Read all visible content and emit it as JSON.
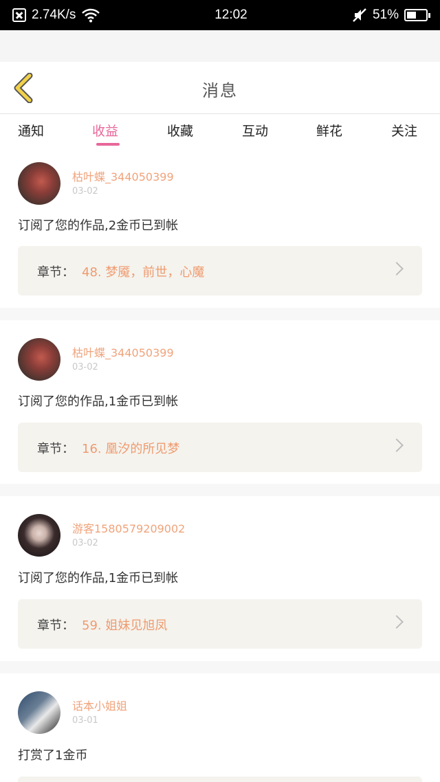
{
  "status_bar": {
    "network_speed": "2.74K/s",
    "time": "12:02",
    "battery": "51%",
    "battery_level": 0.51,
    "icons": [
      "close-box-icon",
      "wifi-icon",
      "mute-icon",
      "battery-icon"
    ]
  },
  "header": {
    "title": "消息",
    "back_icon": "chevron-left-icon"
  },
  "tabs": [
    {
      "label": "通知"
    },
    {
      "label": "收益",
      "active": true
    },
    {
      "label": "收藏"
    },
    {
      "label": "互动"
    },
    {
      "label": "鲜花"
    },
    {
      "label": "关注"
    }
  ],
  "chapter_label": "章节：",
  "messages": [
    {
      "user": "枯叶蝶_344050399",
      "date": "03-02",
      "text": "订阅了您的作品,2金币已到帐",
      "chapter": "48. 梦魇，前世，心魔"
    },
    {
      "user": "枯叶蝶_344050399",
      "date": "03-02",
      "text": "订阅了您的作品,1金币已到帐",
      "chapter": "16. 凰汐的所见梦"
    },
    {
      "user": "游客1580579209002",
      "date": "03-02",
      "text": "订阅了您的作品,1金币已到帐",
      "chapter": "59. 姐妹见旭凤"
    },
    {
      "user": "话本小姐姐",
      "date": "03-01",
      "text": "打赏了1金币"
    }
  ],
  "colors": {
    "accent": "#e8679a",
    "username": "#f0a37b",
    "chapter": "#ef9b6f",
    "back_icon": "#f1d14a"
  }
}
